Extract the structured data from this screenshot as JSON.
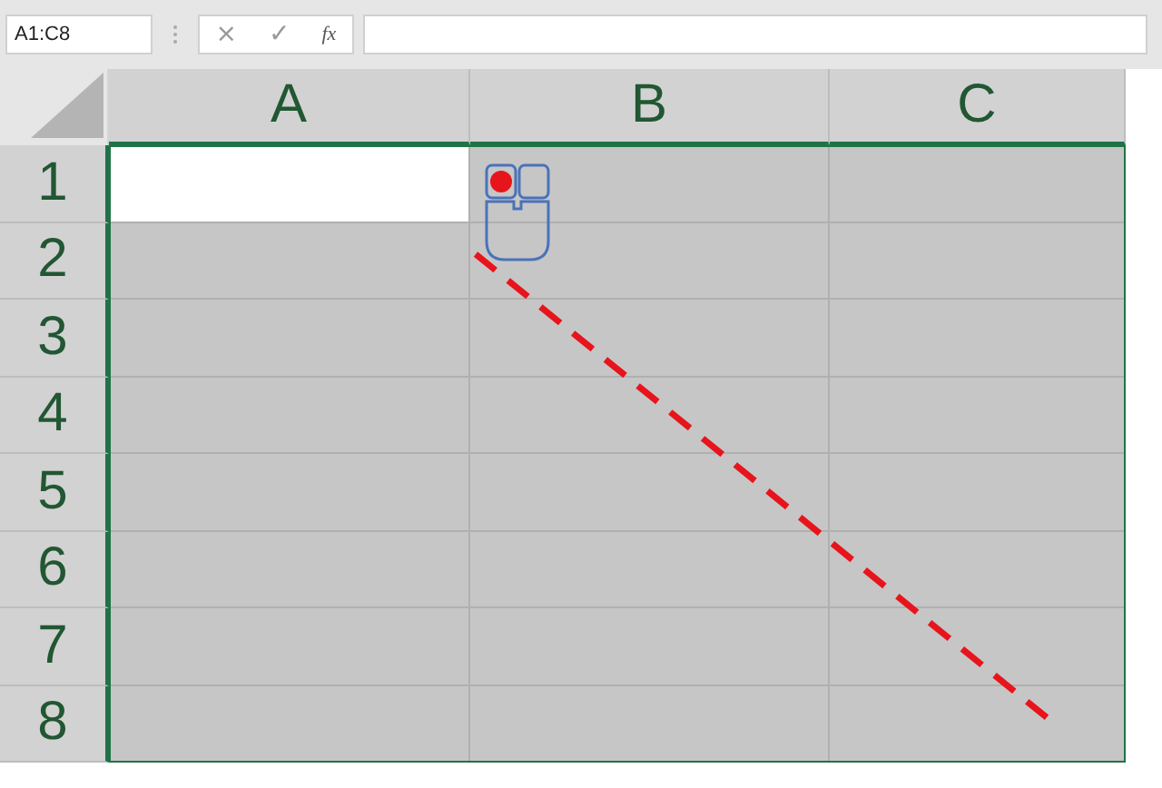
{
  "name_box": {
    "value": "A1:C8"
  },
  "formula_buttons": [
    "×",
    "✓",
    "fx"
  ],
  "columns": [
    "A",
    "B",
    "C"
  ],
  "rows": [
    {
      "label": "1",
      "cells": [
        {
          "active": true
        },
        {
          "active": false
        },
        {
          "active": false
        }
      ]
    },
    {
      "label": "2",
      "cells": [
        {
          "active": false
        },
        {
          "active": false
        },
        {
          "active": false
        }
      ]
    },
    {
      "label": "3",
      "cells": [
        {
          "active": false
        },
        {
          "active": false
        },
        {
          "active": false
        }
      ]
    },
    {
      "label": "4",
      "cells": [
        {
          "active": false
        },
        {
          "active": false
        },
        {
          "active": false
        }
      ]
    },
    {
      "label": "5",
      "cells": [
        {
          "active": false
        },
        {
          "active": false
        },
        {
          "active": false
        }
      ]
    },
    {
      "label": "6",
      "cells": [
        {
          "active": false
        },
        {
          "active": false
        },
        {
          "active": false
        }
      ]
    },
    {
      "label": "7",
      "cells": [
        {
          "active": false
        },
        {
          "active": false
        },
        {
          "active": false
        }
      ]
    },
    {
      "label": "8",
      "cells": [
        {
          "active": false
        },
        {
          "active": false
        },
        {
          "active": false
        }
      ]
    }
  ]
}
